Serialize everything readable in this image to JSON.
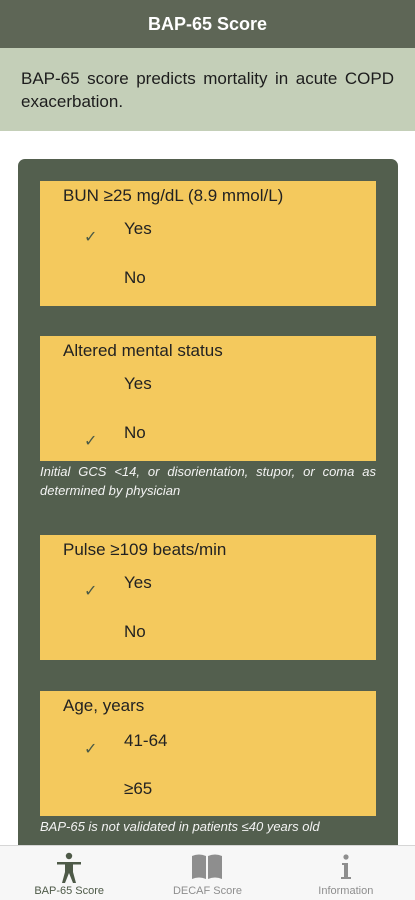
{
  "header": {
    "title": "BAP-65 Score"
  },
  "intro": {
    "text": "BAP-65 score predicts mortality in acute COPD exacerbation."
  },
  "criteria": [
    {
      "title": "BUN ≥25 mg/dL (8.9 mmol/L)",
      "options": [
        {
          "label": "Yes",
          "selected": true
        },
        {
          "label": "No",
          "selected": false
        }
      ],
      "note": ""
    },
    {
      "title": "Altered mental status",
      "options": [
        {
          "label": "Yes",
          "selected": false
        },
        {
          "label": "No",
          "selected": true
        }
      ],
      "note": "Initial GCS <14, or disorientation, stupor, or coma as determined by physician"
    },
    {
      "title": "Pulse ≥109 beats/min",
      "options": [
        {
          "label": "Yes",
          "selected": true
        },
        {
          "label": "No",
          "selected": false
        }
      ],
      "note": ""
    },
    {
      "title": "Age, years",
      "options": [
        {
          "label": "41-64",
          "selected": true
        },
        {
          "label": "≥65",
          "selected": false
        }
      ],
      "note": "BAP-65 is not validated in patients ≤40 years old"
    }
  ],
  "check_glyph": "✓",
  "tabs": [
    {
      "label": "BAP-65 Score",
      "icon": "person-icon",
      "active": true
    },
    {
      "label": "DECAF Score",
      "icon": "book-icon",
      "active": false
    },
    {
      "label": "Information",
      "icon": "info-icon",
      "active": false
    }
  ],
  "colors": {
    "header": "#5e6656",
    "intro_bg": "#c4cfb8",
    "panel": "#535f4e",
    "card": "#f4c95d",
    "tab_active": "#4e5a48",
    "tab_inactive": "#8e8e8e"
  }
}
